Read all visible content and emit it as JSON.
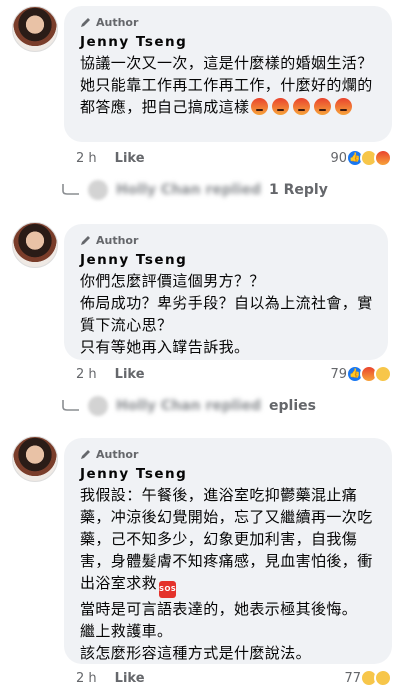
{
  "comments": [
    {
      "author_tag": "Author",
      "name": "Jenny Tseng",
      "text": "協議一次又一次，這是什麼樣的婚姻生活？她只能靠工作再工作再工作，什麼好的爛的都答應，把自己搞成這樣",
      "time": "2 h",
      "like": "Like",
      "reaction_count": "90"
    },
    {
      "author_tag": "Author",
      "name": "Jenny Tseng",
      "text": "你們怎麼評價這個男方？？\n佈局成功？卑劣手段？自以為上流社會，實質下流心思？\n只有等她再入罉告訴我。",
      "time": "2 h",
      "like": "Like",
      "reaction_count": "79"
    },
    {
      "author_tag": "Author",
      "name": "Jenny Tseng",
      "text_a": "我假設：午餐後，進浴室吃抑鬱藥混止痛藥，冲涼後幻覺開始，忘了又繼續再一次吃藥，己不知多少，幻象更加利害，自我傷害，身體髮膚不知疼痛感，見血害怕後，衝出浴室求救",
      "text_b": "\n當時是可言語表達的，她表示極其後悔。\n繼上救護車。\n該怎麼形容這種方式是什麼說法。",
      "sos_label": "SOS",
      "time": "2 h",
      "like": "Like",
      "reaction_count": "77"
    }
  ],
  "replies": [
    {
      "name": "Holly Chan replied",
      "count": "1 Reply"
    },
    {
      "name": "Holly Chan replied",
      "count": "eplies"
    }
  ],
  "icons": {
    "author": "pencil-icon",
    "reply": "reply-arrow-icon",
    "reactions": [
      "like",
      "sad",
      "angry",
      "care"
    ]
  },
  "colors": {
    "accent": "#1877f2",
    "bubble": "#f0f2f5",
    "secondary_text": "#65676b"
  }
}
